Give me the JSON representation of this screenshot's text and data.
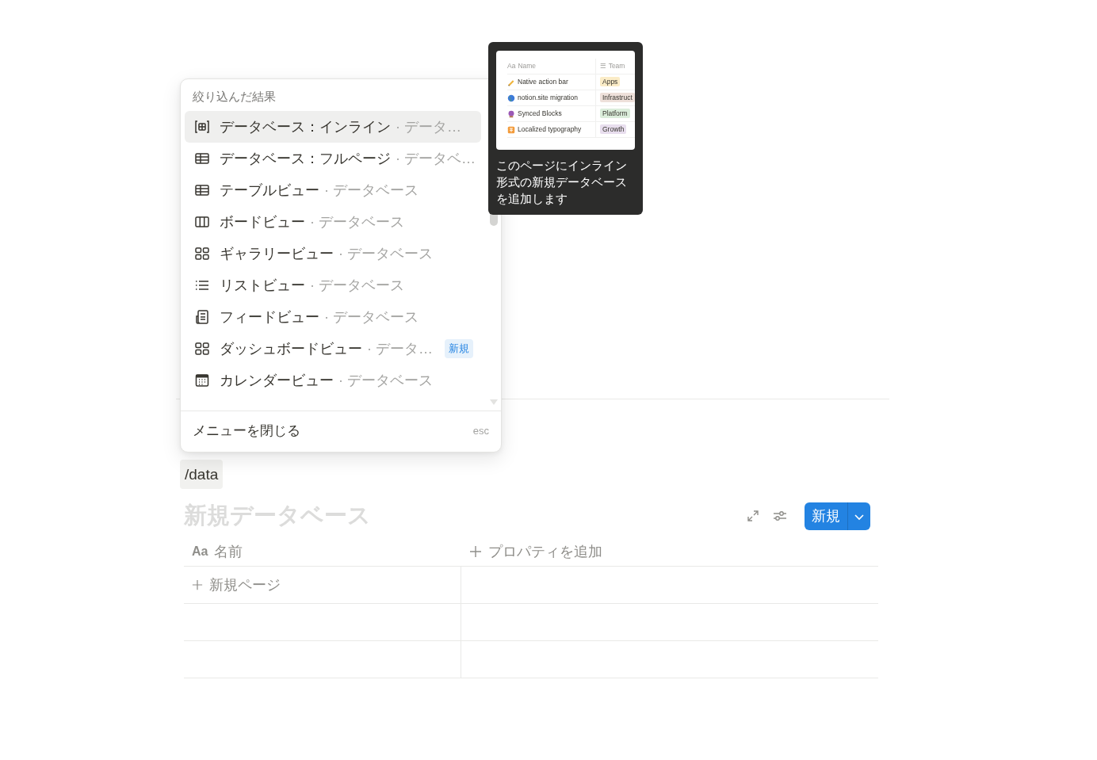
{
  "menu": {
    "heading": "絞り込んだ結果",
    "items": [
      {
        "kind": "inline",
        "label": "データベース：インライン",
        "hint": "· データ…",
        "selected": true
      },
      {
        "kind": "table",
        "label": "データベース：フルページ",
        "hint": "· データベ…",
        "selected": false
      },
      {
        "kind": "table",
        "label": "テーブルビュー",
        "hint": "· データベース",
        "selected": false
      },
      {
        "kind": "board",
        "label": "ボードビュー",
        "hint": "· データベース",
        "selected": false
      },
      {
        "kind": "gallery",
        "label": "ギャラリービュー",
        "hint": "· データベース",
        "selected": false
      },
      {
        "kind": "list",
        "label": "リストビュー",
        "hint": "· データベース",
        "selected": false
      },
      {
        "kind": "feed",
        "label": "フィードビュー",
        "hint": "· データベース",
        "selected": false
      },
      {
        "kind": "gallery",
        "label": "ダッシュボードビュー",
        "hint": "· データ…",
        "selected": false,
        "badge": "新規"
      },
      {
        "kind": "calendar",
        "label": "カレンダービュー",
        "hint": "· データベース",
        "selected": false
      }
    ],
    "footer": {
      "label": "メニューを閉じる",
      "shortcut": "esc"
    }
  },
  "tooltip": {
    "preview": {
      "columns": [
        {
          "icon_text": "Aa",
          "label": "Name"
        },
        {
          "icon_text": "☰",
          "label": "Team"
        }
      ],
      "rows": [
        {
          "name": "Native action bar",
          "team": "Apps",
          "color": "#fbecc7"
        },
        {
          "name": "notion.site migration",
          "team": "Infrastruct",
          "color": "#eee0da"
        },
        {
          "name": "Synced Blocks",
          "team": "Platform",
          "color": "#dbeddb"
        },
        {
          "name": "Localized typography",
          "team": "Growth",
          "color": "#e8deee"
        }
      ]
    },
    "text": "このページにインライン形式の新規データベースを追加します"
  },
  "command": "/data",
  "database": {
    "title": "新規データベース",
    "new_button": "新規",
    "columns": [
      {
        "kind": "title",
        "icon_text": "Aa",
        "label": "名前"
      },
      {
        "kind": "add",
        "label": "プロパティを追加"
      }
    ],
    "new_row_label": "新規ページ"
  }
}
